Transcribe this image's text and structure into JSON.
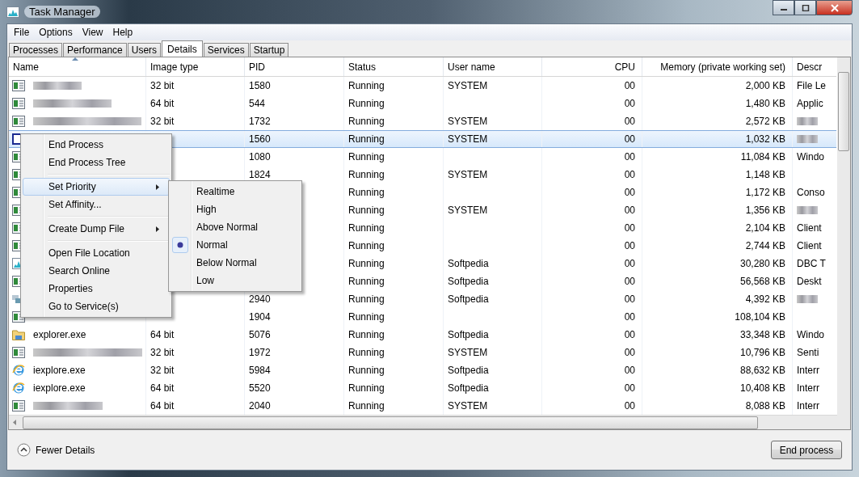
{
  "window": {
    "title": "Task Manager"
  },
  "menu": [
    "File",
    "Options",
    "View",
    "Help"
  ],
  "tabs": [
    {
      "label": "Processes",
      "selected": false
    },
    {
      "label": "Performance",
      "selected": false
    },
    {
      "label": "Users",
      "selected": false
    },
    {
      "label": "Details",
      "selected": true
    },
    {
      "label": "Services",
      "selected": false
    },
    {
      "label": "Startup",
      "selected": false
    }
  ],
  "table": {
    "columns": [
      {
        "label": "Name",
        "sorted": true
      },
      {
        "label": "Image type",
        "sorted": false
      },
      {
        "label": "PID",
        "sorted": false
      },
      {
        "label": "Status",
        "sorted": false
      },
      {
        "label": "User name",
        "sorted": false
      },
      {
        "label": "CPU",
        "sorted": false
      },
      {
        "label": "Memory (private working set)",
        "sorted": false
      },
      {
        "label": "Descr",
        "sorted": false
      }
    ],
    "rows": [
      {
        "kind": "app",
        "selected": false,
        "cells": [
          {
            "kind": "blurred"
          },
          "32 bit",
          "1580",
          "Running",
          "SYSTEM",
          "00",
          "2,000 KB",
          "File Le"
        ]
      },
      {
        "kind": "app",
        "selected": false,
        "cells": [
          {
            "kind": "blurred"
          },
          "64 bit",
          "544",
          "Running",
          null,
          "00",
          "1,480 KB",
          "Applic"
        ]
      },
      {
        "kind": "app",
        "selected": false,
        "cells": [
          {
            "kind": "blurred"
          },
          "32 bit",
          "1732",
          "Running",
          "SYSTEM",
          "00",
          "2,572 KB",
          {
            "kind": "blurred"
          }
        ]
      },
      {
        "kind": "window",
        "selected": true,
        "cells": [
          null,
          null,
          "1560",
          "Running",
          "SYSTEM",
          "00",
          "1,032 KB",
          {
            "kind": "blurred"
          }
        ]
      },
      {
        "kind": "app",
        "selected": false,
        "cells": [
          null,
          null,
          "1080",
          "Running",
          null,
          "00",
          "11,084 KB",
          "Windo"
        ]
      },
      {
        "kind": "app",
        "selected": false,
        "cells": [
          null,
          null,
          "1824",
          "Running",
          "SYSTEM",
          "00",
          "1,148 KB",
          null
        ]
      },
      {
        "kind": "app",
        "selected": false,
        "cells": [
          null,
          null,
          null,
          "Running",
          null,
          "00",
          "1,172 KB",
          "Conso"
        ]
      },
      {
        "kind": "app",
        "selected": false,
        "cells": [
          null,
          null,
          null,
          "Running",
          "SYSTEM",
          "00",
          "1,356 KB",
          {
            "kind": "blurred"
          }
        ]
      },
      {
        "kind": "app",
        "selected": false,
        "cells": [
          null,
          null,
          null,
          "Running",
          null,
          "00",
          "2,104 KB",
          "Client"
        ]
      },
      {
        "kind": "app",
        "selected": false,
        "cells": [
          null,
          null,
          null,
          "Running",
          null,
          "00",
          "2,744 KB",
          "Client"
        ]
      },
      {
        "kind": "chart",
        "selected": false,
        "cells": [
          null,
          null,
          null,
          "Running",
          "Softpedia",
          "00",
          "30,280 KB",
          "DBC T"
        ]
      },
      {
        "kind": "app",
        "selected": false,
        "cells": [
          null,
          null,
          null,
          "Running",
          "Softpedia",
          "00",
          "56,568 KB",
          "Deskt"
        ]
      },
      {
        "kind": "blurred",
        "selected": false,
        "cells": [
          null,
          null,
          "2940",
          "Running",
          "Softpedia",
          "00",
          "4,392 KB",
          {
            "kind": "blurred"
          }
        ]
      },
      {
        "kind": "app",
        "selected": false,
        "cells": [
          null,
          null,
          "1904",
          "Running",
          null,
          "00",
          "108,104 KB",
          null
        ]
      },
      {
        "kind": "folder",
        "selected": false,
        "cells": [
          "explorer.exe",
          "64 bit",
          "5076",
          "Running",
          "Softpedia",
          "00",
          "33,348 KB",
          "Windo"
        ]
      },
      {
        "kind": "app",
        "selected": false,
        "cells": [
          {
            "kind": "blurred"
          },
          "32 bit",
          "1972",
          "Running",
          "SYSTEM",
          "00",
          "10,796 KB",
          "Senti"
        ]
      },
      {
        "kind": "globe",
        "selected": false,
        "cells": [
          "iexplore.exe",
          "32 bit",
          "5984",
          "Running",
          "Softpedia",
          "00",
          "88,632 KB",
          "Interr"
        ]
      },
      {
        "kind": "globe",
        "selected": false,
        "cells": [
          "iexplore.exe",
          "64 bit",
          "5520",
          "Running",
          "Softpedia",
          "00",
          "10,408 KB",
          "Interr"
        ]
      },
      {
        "kind": "app",
        "selected": false,
        "cells": [
          {
            "kind": "blurred"
          },
          "64 bit",
          "2040",
          "Running",
          "SYSTEM",
          "00",
          "8,088 KB",
          "Interr"
        ]
      }
    ]
  },
  "context_menu": {
    "items": [
      {
        "kind": "item",
        "label": "End Process",
        "selected": false
      },
      {
        "kind": "item",
        "label": "End Process Tree",
        "selected": false
      },
      {
        "kind": "separator"
      },
      {
        "kind": "submenu",
        "label": "Set Priority",
        "selected": true
      },
      {
        "kind": "item",
        "label": "Set Affinity...",
        "selected": false
      },
      {
        "kind": "separator"
      },
      {
        "kind": "submenu",
        "label": "Create Dump File",
        "selected": false
      },
      {
        "kind": "separator"
      },
      {
        "kind": "item",
        "label": "Open File Location",
        "selected": false
      },
      {
        "kind": "item",
        "label": "Search Online",
        "selected": false
      },
      {
        "kind": "item",
        "label": "Properties",
        "selected": false
      },
      {
        "kind": "item",
        "label": "Go to Service(s)",
        "selected": false
      }
    ]
  },
  "priority_menu": {
    "items": [
      {
        "label": "Realtime",
        "selected": false
      },
      {
        "label": "High",
        "selected": false
      },
      {
        "label": "Above Normal",
        "selected": false
      },
      {
        "label": "Normal",
        "selected": true
      },
      {
        "label": "Below Normal",
        "selected": false
      },
      {
        "label": "Low",
        "selected": false
      }
    ]
  },
  "footer": {
    "toggle": "Fewer Details",
    "button": "End process"
  }
}
